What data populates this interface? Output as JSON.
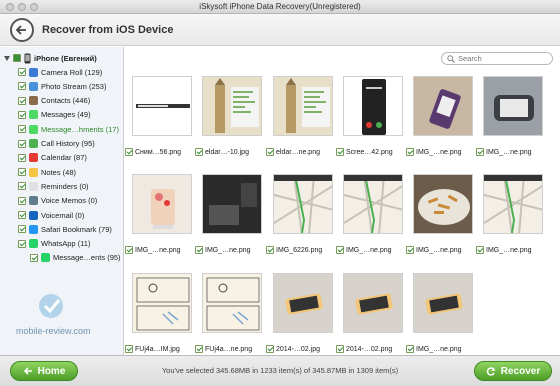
{
  "window": {
    "title": "iSkysoft iPhone Data Recovery(Unregistered)"
  },
  "header": {
    "title": "Recover from iOS Device"
  },
  "search": {
    "placeholder": "Search"
  },
  "device": {
    "name": "iPhone (Евгений)"
  },
  "sidebar": {
    "items": [
      {
        "label": "Camera Roll (129)",
        "color": "#3a7bd5"
      },
      {
        "label": "Photo Stream (253)",
        "color": "#4a90d9"
      },
      {
        "label": "Contacts (446)",
        "color": "#8b6a4a"
      },
      {
        "label": "Messages (49)",
        "color": "#4cd964"
      },
      {
        "label": "Message…hments (17)",
        "color": "#4cd964",
        "highlighted": true
      },
      {
        "label": "Call History (95)",
        "color": "#4caf50"
      },
      {
        "label": "Calendar (87)",
        "color": "#e53935"
      },
      {
        "label": "Notes (48)",
        "color": "#f4c542"
      },
      {
        "label": "Reminders (0)",
        "color": "#e0e0e0"
      },
      {
        "label": "Voice Memos (0)",
        "color": "#607d8b"
      },
      {
        "label": "Voicemail (0)",
        "color": "#1565c0"
      },
      {
        "label": "Safari Bookmark (79)",
        "color": "#2196f3"
      },
      {
        "label": "WhatsApp (11)",
        "color": "#25d366"
      },
      {
        "label": "Message…ents (95)",
        "color": "#25d366"
      }
    ]
  },
  "files": [
    {
      "name": "Сним…56.png",
      "icon": "screenshot-dark-bar-thumbnail"
    },
    {
      "name": "eldar…-10.jpg",
      "icon": "big-ben-chart-thumbnail"
    },
    {
      "name": "eldar…ne.png",
      "icon": "big-ben-chart-thumbnail"
    },
    {
      "name": "Scree…42.png",
      "icon": "phone-call-screen-thumbnail"
    },
    {
      "name": "IMG_…ne.png",
      "icon": "purple-device-thumbnail"
    },
    {
      "name": "IMG_…ne.png",
      "icon": "device-in-hand-thumbnail"
    },
    {
      "name": "IMG_…ne.png",
      "icon": "drink-glass-thumbnail"
    },
    {
      "name": "IMG_…ne.png",
      "icon": "dark-room-thumbnail"
    },
    {
      "name": "IMG_6226.png",
      "icon": "map-thumbnail"
    },
    {
      "name": "IMG_…ne.png",
      "icon": "map-thumbnail"
    },
    {
      "name": "IMG_…ne.png",
      "icon": "food-plate-thumbnail"
    },
    {
      "name": "IMG_…ne.png",
      "icon": "map-thumbnail"
    },
    {
      "name": "FUj4a…IM.jpg",
      "icon": "comic-sketch-thumbnail"
    },
    {
      "name": "FUj4a…ne.png",
      "icon": "comic-sketch-thumbnail"
    },
    {
      "name": "2014-…02.jpg",
      "icon": "phone-on-desk-thumbnail"
    },
    {
      "name": "2014-…02.png",
      "icon": "phone-on-desk-thumbnail"
    },
    {
      "name": "IMG_…ne.png",
      "icon": "phone-on-desk-thumbnail"
    }
  ],
  "footer": {
    "home_label": "Home",
    "recover_label": "Recover",
    "status": "You've selected 345.68MB in 1233 item(s) of 345.87MB in 1309 item(s)"
  },
  "watermark": {
    "text": "mobile-review.com"
  },
  "colors": {
    "accent": "#4d9f2a",
    "check": "#2b8a2b"
  }
}
